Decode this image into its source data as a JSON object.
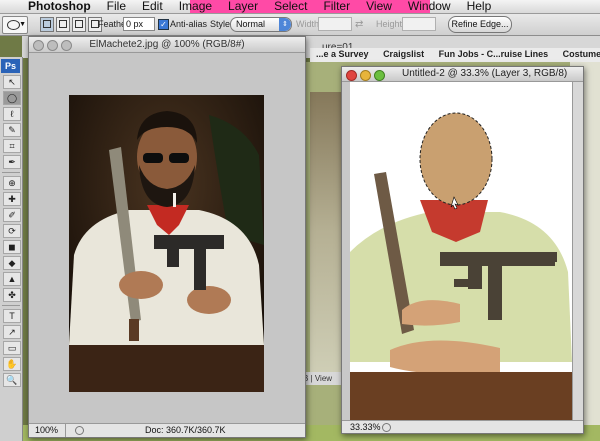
{
  "menubar": {
    "apple": "",
    "items": [
      "Photoshop",
      "File",
      "Edit",
      "Image",
      "Layer",
      "Select",
      "Filter",
      "View",
      "Window",
      "Help"
    ]
  },
  "options": {
    "feather_label": "Feather:",
    "feather_value": "0 px",
    "antialias_label": "Anti-alias",
    "style_label": "Style:",
    "style_value": "Normal",
    "width_label": "Width:",
    "height_label": "Height:",
    "refine_label": "Refine Edge..."
  },
  "bg": {
    "tabs": [
      "...e a Survey",
      "Craigslist",
      "Fun Jobs - C...ruise Lines",
      "Costumes by"
    ],
    "strip_text": "ure=01",
    "bottombar": "B | View"
  },
  "toolbox": {
    "logo": "Ps",
    "tools": [
      "↖",
      "◯",
      "ℓ",
      "✎",
      "⌗",
      "✒",
      "⊕",
      "✚",
      "✐",
      "⟳",
      "◼",
      "◆",
      "▲",
      "✤",
      "T",
      "↗",
      "▭",
      "✋",
      "🔍"
    ]
  },
  "win1": {
    "title": "ElMachete2.jpg @ 100% (RGB/8#)",
    "zoom": "100%",
    "doc": "Doc: 360.7K/360.7K"
  },
  "win2": {
    "title": "Untitled-2 @ 33.3% (Layer 3, RGB/8)",
    "zoom": "33.33%"
  },
  "colors": {
    "menu_highlight": "#ff4aa6",
    "face": "#c9a070",
    "bandana": "#c53a2e",
    "shirt": "#d6deaa",
    "machete": "#6e5a45",
    "gun": "#4a4236",
    "table": "#6a3f22",
    "skin": "#d4a277"
  }
}
